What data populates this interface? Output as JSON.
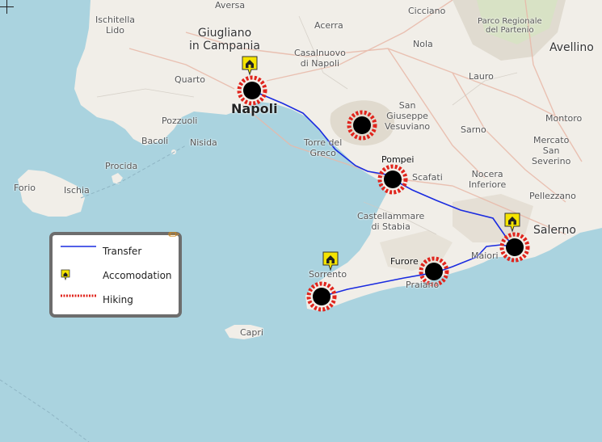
{
  "map": {
    "labels": {
      "aversa": "Aversa",
      "cicciano": "Cicciano",
      "ischitella_lido": "Ischitella\nLido",
      "acerra": "Acerra",
      "parco": "Parco Regionale\ndel Partenio",
      "giugliano": "Giugliano\nin Campania",
      "casalnuovo": "Casalnuovo\ndi Napoli",
      "nola": "Nola",
      "avellino": "Avellino",
      "quarto": "Quarto",
      "lauro": "Lauro",
      "napoli": "Napoli",
      "san_giuseppe": "San\nGiuseppe\nVesuviano",
      "pozzuoli": "Pozzuoli",
      "montoro": "Montoro",
      "bacoli": "Bacoli",
      "nisida": "Nisida",
      "torre_del_greco": "Torre del\nGreco",
      "sarno": "Sarno",
      "mercato": "Mercato\nSan\nSeverino",
      "procida": "Procida",
      "pompei": "Pompei",
      "scafati": "Scafati",
      "nocera": "Nocera\nInferiore",
      "forio": "Forio",
      "ischia": "Ischia",
      "pellezzano": "Pellezzano",
      "castellammare": "Castellammare\ndi Stabia",
      "salerno": "Salerno",
      "maiori": "Maiori",
      "furore": "Furore",
      "praiano": "Praiano",
      "sorrento": "Sorrento",
      "capri": "Capri"
    }
  },
  "legend": {
    "transfer": "Transfer",
    "accommodation": "Accomodation",
    "hiking": "Hiking"
  },
  "colors": {
    "sea": "#aad3df",
    "land": "#f1eee8",
    "route": "#1a2be0",
    "hiking_ring": "#e0241c",
    "accommodation_marker": "#f5e400"
  }
}
